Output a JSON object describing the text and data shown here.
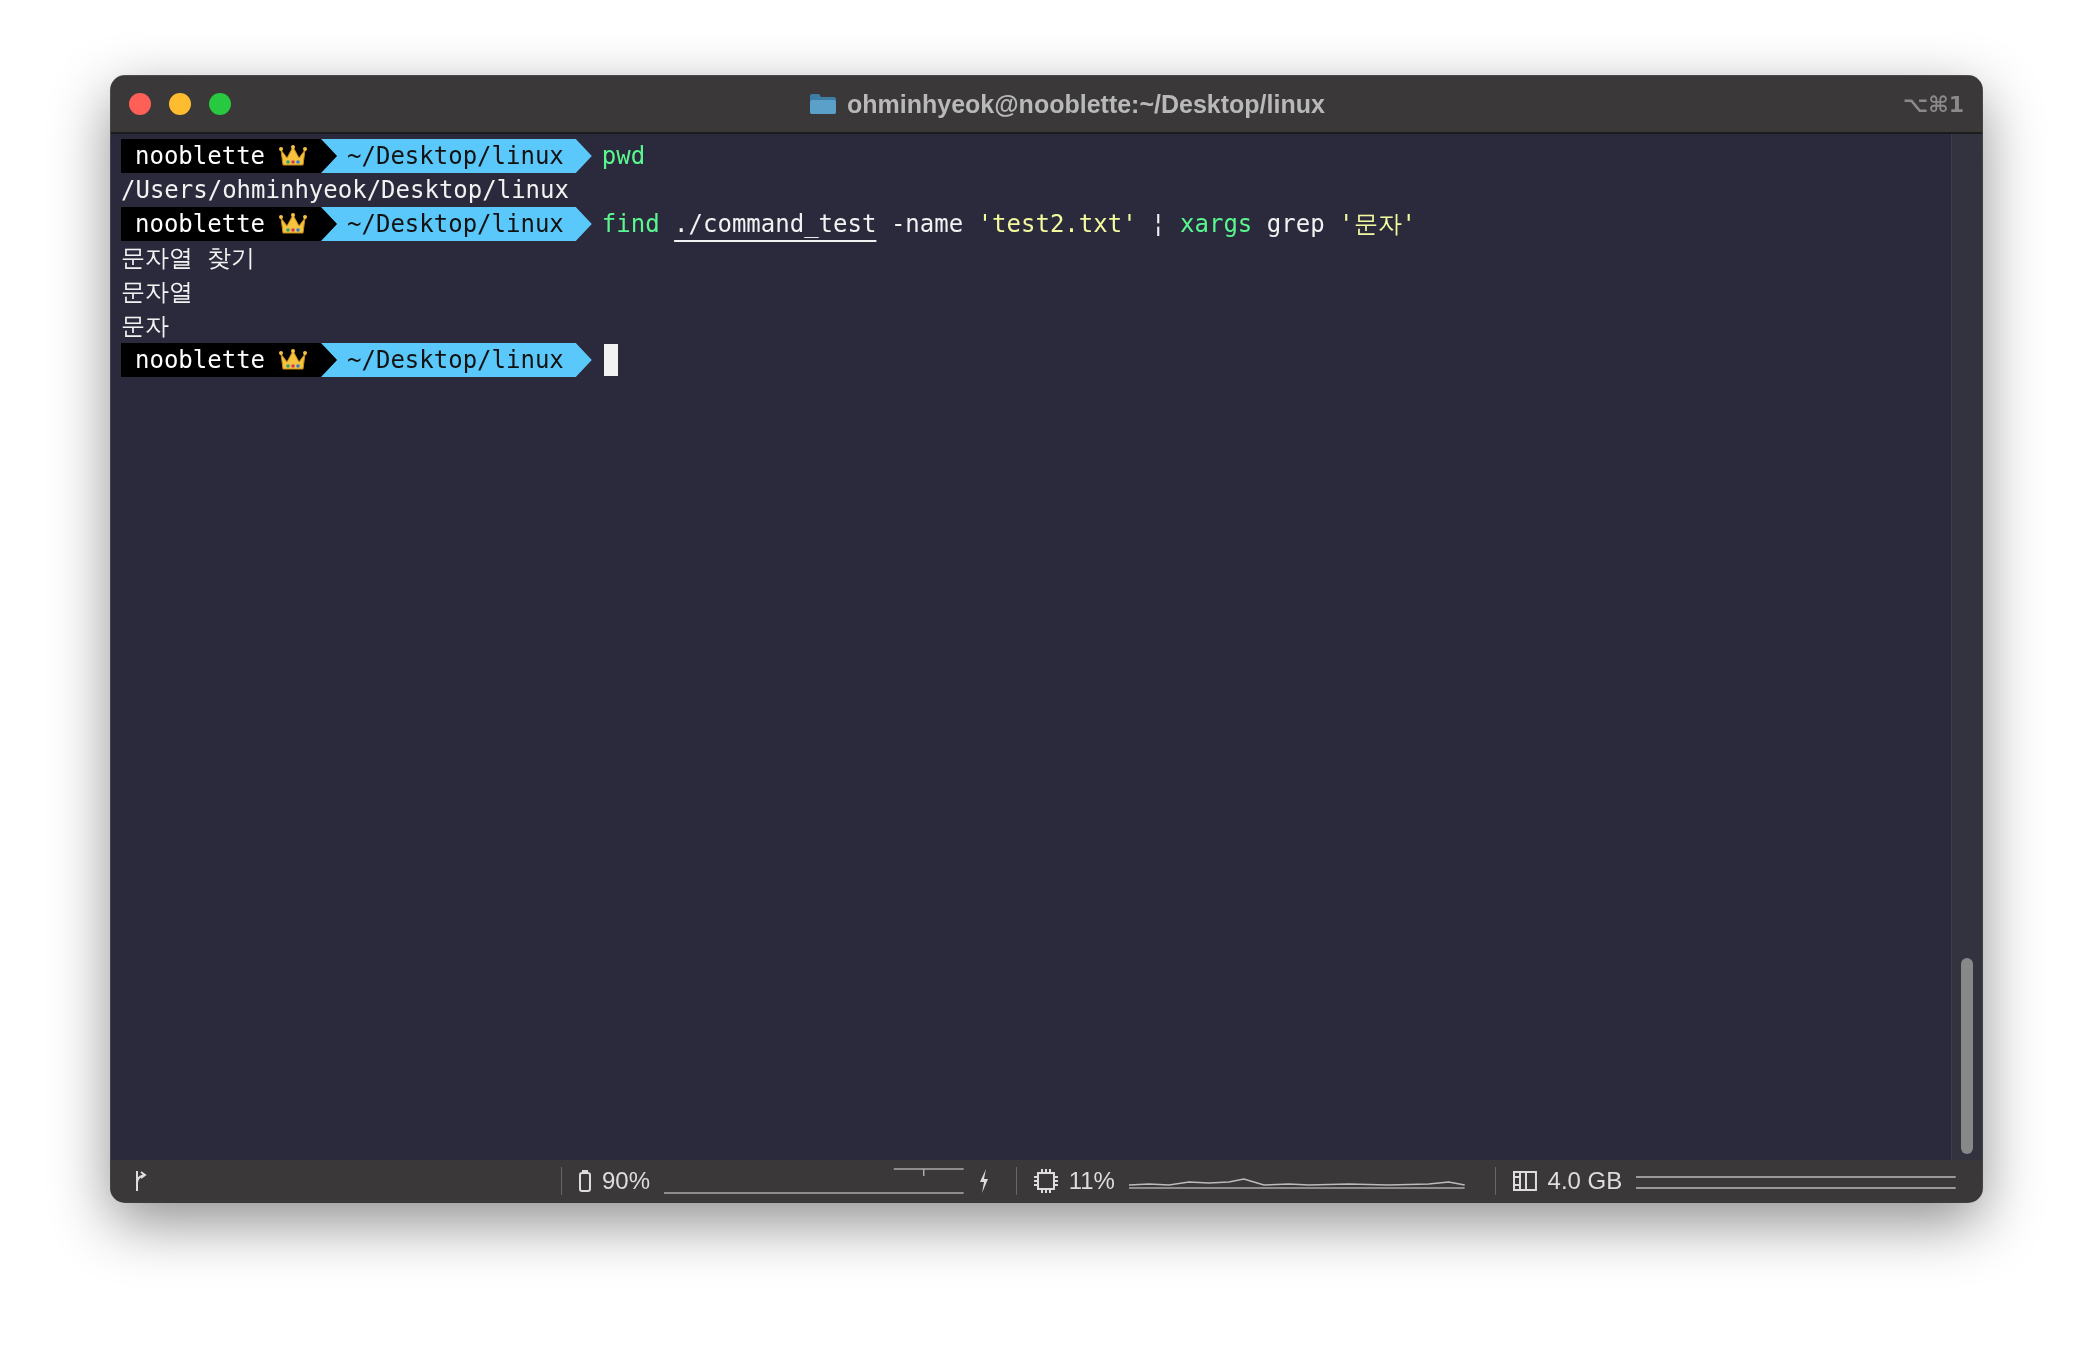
{
  "window": {
    "title": "ohminhyeok@nooblette:~/Desktop/linux",
    "shortcut": "⌥⌘1"
  },
  "lines": [
    {
      "kind": "prompt",
      "host": "nooblette",
      "path": "~/Desktop/linux",
      "cursor": false,
      "command": [
        {
          "text": "pwd",
          "kind": "command"
        }
      ]
    },
    {
      "kind": "output",
      "text": "/Users/ohminhyeok/Desktop/linux"
    },
    {
      "kind": "prompt",
      "host": "nooblette",
      "path": "~/Desktop/linux",
      "cursor": false,
      "command": [
        {
          "text": "find",
          "kind": "command"
        },
        {
          "text": "./command_test",
          "kind": "path"
        },
        {
          "text": "-name",
          "kind": "plain"
        },
        {
          "text": "'test2.txt'",
          "kind": "string"
        },
        {
          "text": "¦",
          "kind": "plain"
        },
        {
          "text": "xargs",
          "kind": "command"
        },
        {
          "text": "grep",
          "kind": "plain"
        },
        {
          "text": "'문자'",
          "kind": "string"
        }
      ]
    },
    {
      "kind": "output",
      "text": "문자열 찾기"
    },
    {
      "kind": "output",
      "text": "문자열"
    },
    {
      "kind": "output",
      "text": "문자"
    },
    {
      "kind": "prompt",
      "host": "nooblette",
      "path": "~/Desktop/linux",
      "cursor": true
    }
  ],
  "status_bar": {
    "battery": "90%",
    "cpu": "11%",
    "memory": "4.0 GB"
  }
}
